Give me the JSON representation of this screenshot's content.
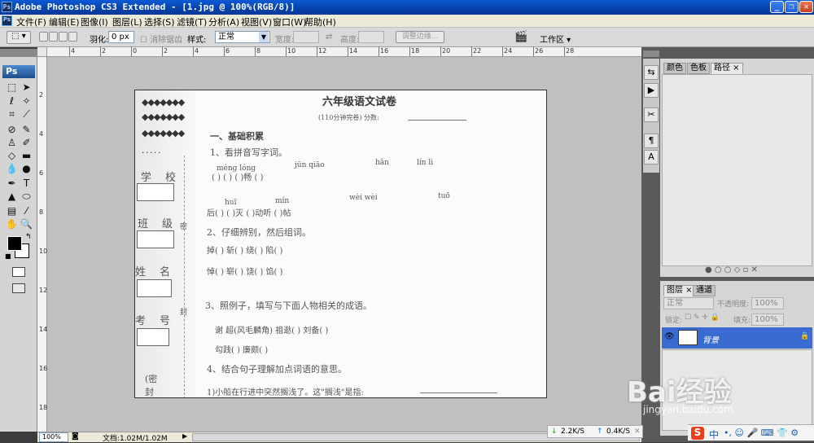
{
  "window": {
    "title": "Adobe Photoshop CS3 Extended - [1.jpg @ 100%(RGB/8)]",
    "app_icon": "Ps"
  },
  "menu": [
    "文件(F)",
    "编辑(E)",
    "图像(I)",
    "图层(L)",
    "选择(S)",
    "滤镜(T)",
    "分析(A)",
    "视图(V)",
    "窗口(W)",
    "帮助(H)"
  ],
  "options": {
    "feather_label": "羽化:",
    "feather_value": "0 px",
    "antialias_label": "消除锯齿",
    "style_label": "样式:",
    "style_value": "正常",
    "width_label": "宽度:",
    "height_label": "高度:",
    "refine_label": "调整边缘...",
    "workspace_label": "工作区 ▾"
  },
  "toolbox": {
    "ps_label": "Ps"
  },
  "ruler": {
    "top": [
      "4",
      "2",
      "0",
      "2",
      "4",
      "6",
      "8",
      "10",
      "12",
      "14",
      "16",
      "18",
      "20",
      "22",
      "24",
      "26",
      "28"
    ],
    "left": [
      "2",
      "4",
      "6",
      "8",
      "10",
      "12",
      "14",
      "16",
      "18"
    ]
  },
  "document": {
    "title": "六年级语文试卷",
    "subtitle": "(110分钟完卷)    分数:",
    "section1": "一、基础积累",
    "q1": "1、看拼音写字词。",
    "pinyin1": [
      "méng  lóng",
      "jūn  qiāo",
      "hǎn",
      "lín  lì"
    ],
    "brackets1": "(          )   (          )   (     )畅 (          )",
    "pinyin2": [
      "huī",
      "mín",
      "wèi wèi",
      "tuō"
    ],
    "brackets2": "后(     )     (     )灭     (     )动听     (     )帖",
    "q2": "2、仔细辨别，然后组词。",
    "row2a": "掉(       )   斩(       )   绕(       )   陷(       )",
    "row2b": "悼(       )   崭(       )   饶(       )   馅(       )",
    "q3": "3、照例子，填写与下面人物相关的成语。",
    "row3a": "谢  超(风毛麟角)     祖逖(         )   刘备(         )",
    "row3b": "勾践(         )     廉颇(         )",
    "q4": "4、结合句子理解加点词语的意思。",
    "q4a": "1)小船在行进中突然搁浅了。这\"搁浅\"是指:",
    "side_labels": [
      "学",
      "校",
      "班",
      "级",
      "姓",
      "名",
      "考",
      "号",
      "(密",
      "封"
    ],
    "seal": [
      "密",
      "封"
    ]
  },
  "status": {
    "zoom": "100%",
    "doc_info": "文档:1.02M/1.02M"
  },
  "panel1": {
    "tabs": [
      "颜色",
      "色板",
      "路径 ×"
    ]
  },
  "panel2": {
    "tabs": [
      "图层 ×",
      "通道"
    ],
    "blend_mode": "正常",
    "opacity_label": "不透明度:",
    "opacity_value": "100%",
    "lock_label": "锁定:",
    "fill_label": "填充:",
    "fill_value": "100%",
    "layer_name": "背景"
  },
  "tray": {
    "down": "2.2K/S",
    "up": "0.4K/S",
    "ime": "中"
  },
  "watermark": {
    "brand": "Bai经验",
    "url": "jingyan.baidu.com"
  }
}
